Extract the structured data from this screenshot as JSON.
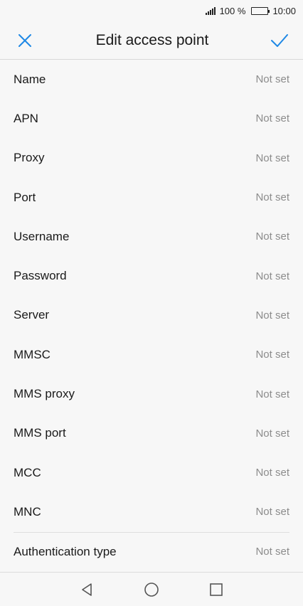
{
  "status_bar": {
    "battery_percent": "100 %",
    "time": "10:00"
  },
  "app_bar": {
    "title": "Edit access point"
  },
  "fields": [
    {
      "label": "Name",
      "value": "Not set"
    },
    {
      "label": "APN",
      "value": "Not set"
    },
    {
      "label": "Proxy",
      "value": "Not set"
    },
    {
      "label": "Port",
      "value": "Not set"
    },
    {
      "label": "Username",
      "value": "Not set"
    },
    {
      "label": "Password",
      "value": "Not set"
    },
    {
      "label": "Server",
      "value": "Not set"
    },
    {
      "label": "MMSC",
      "value": "Not set"
    },
    {
      "label": "MMS proxy",
      "value": "Not set"
    },
    {
      "label": "MMS port",
      "value": "Not set"
    },
    {
      "label": "MCC",
      "value": "Not set"
    },
    {
      "label": "MNC",
      "value": "Not set"
    },
    {
      "label": "Authentication type",
      "value": "Not set"
    }
  ],
  "colors": {
    "accent": "#1e88e5"
  },
  "icons": {
    "cancel": "close-icon",
    "save": "check-icon",
    "back": "back-triangle-icon",
    "home": "home-circle-icon",
    "recents": "recents-square-icon"
  }
}
